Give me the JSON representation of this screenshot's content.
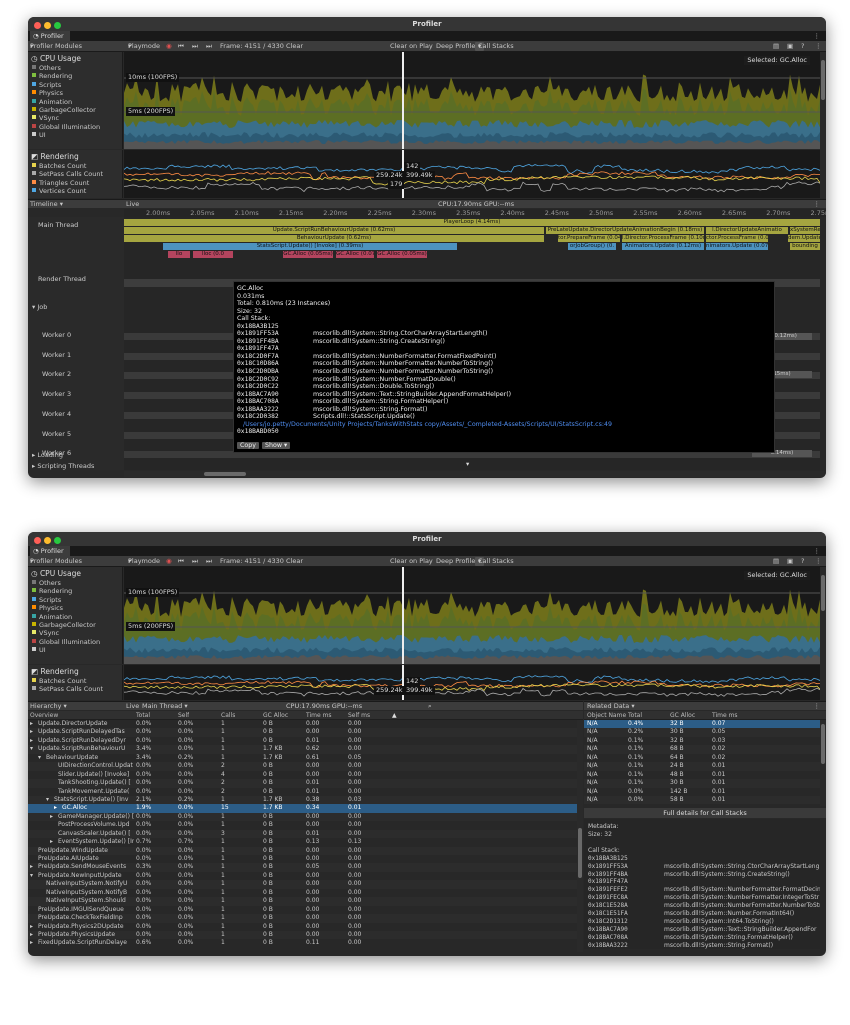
{
  "window": {
    "title": "Profiler",
    "tab": "Profiler"
  },
  "toolbar": {
    "modules": "Profiler Modules",
    "playmode": "Playmode",
    "frame": "Frame: 4151 / 4330",
    "clear": "Clear",
    "clear_on_play": "Clear on Play",
    "deep_profile": "Deep Profile",
    "call_stacks": "Call Stacks"
  },
  "cpu": {
    "title": "CPU Usage",
    "legend": [
      {
        "label": "Others",
        "color": "#777777"
      },
      {
        "label": "Rendering",
        "color": "#7fbf3f"
      },
      {
        "label": "Scripts",
        "color": "#4fa7e3"
      },
      {
        "label": "Physics",
        "color": "#ff8c00"
      },
      {
        "label": "Animation",
        "color": "#37a5a5"
      },
      {
        "label": "GarbageCollector",
        "color": "#c8b400"
      },
      {
        "label": "VSync",
        "color": "#e8e868"
      },
      {
        "label": "Global Illumination",
        "color": "#bb4444"
      },
      {
        "label": "UI",
        "color": "#cccccc"
      }
    ],
    "label_10": "10ms (100FPS)",
    "label_5": "5ms (200FPS)",
    "selected": "Selected: GC.Alloc"
  },
  "rendering": {
    "title": "Rendering",
    "legend": [
      {
        "label": "Batches Count",
        "color": "#e8d44d"
      },
      {
        "label": "SetPass Calls Count",
        "color": "#aaaaaa"
      },
      {
        "label": "Triangles Count",
        "color": "#ff8c44"
      },
      {
        "label": "Vertices Count",
        "color": "#4fa7e3"
      }
    ],
    "values": [
      "142",
      "259.24k",
      "399.49k",
      "179"
    ]
  },
  "timeline": {
    "view": "Timeline",
    "live": "Live",
    "cpu": "CPU:17.90ms  GPU:--ms",
    "ticks": [
      "2.00ms",
      "2.05ms",
      "2.10ms",
      "2.15ms",
      "2.20ms",
      "2.25ms",
      "2.30ms",
      "2.35ms",
      "2.40ms",
      "2.45ms",
      "2.50ms",
      "2.55ms",
      "2.60ms",
      "2.65ms",
      "2.70ms",
      "2.75ms"
    ],
    "threads": {
      "main": "Main Thread",
      "render": "Render Thread",
      "job": "Job",
      "workers": [
        "Worker 0",
        "Worker 1",
        "Worker 2",
        "Worker 3",
        "Worker 4",
        "Worker 5",
        "Worker 6"
      ],
      "loading": "Loading",
      "scripting": "Scripting Threads"
    },
    "bars": {
      "player_loop": "PlayerLoop (4.14ms)",
      "run_behaviour": "Update.ScriptRunBehaviourUpdate (0.62ms)",
      "behaviour_update": "BehaviourUpdate (0.62ms)",
      "stats_update": "StatsScript.Update() [Invoke] (0.39ms)",
      "pre_late": "PreLateUpdate.DirectorUpdateAnimationBegin (0.18ms)",
      "director_anim": "l.DirectorUpdateAnimatio",
      "system": "xSystemRe",
      "prepare_frame": "tor.PrepareFrame (0.04ms)",
      "process_frame": "l.Director.ProcessFrame (0.10ms)",
      "process_frame2": "ctor.ProcessFrame (0.07",
      "item_update": "dem.Update",
      "job_group": "orJobGroup() (0.",
      "anim_update": "Animators.Update (0.12ms)",
      "anim_update2": "nimators.Update (0.07m",
      "bounding": "bounding",
      "gc1": "GC.Alloc (0.05ms)",
      "gc2": "GC.Alloc (0.07ms)",
      "gc3": "GC.Alloc (0.05ms)",
      "gc_short": "llo",
      "gc_short2": "lloc (0.0",
      "worker0_time": "e (0.12ms)",
      "worker2_time": "15ms)",
      "worker6_time": "0.14ms)"
    }
  },
  "tooltip": {
    "name": "GC.Alloc",
    "time": "0.031ms",
    "total": "Total: 0.810ms (23 Instances)",
    "size": "Size: 32",
    "call_stack": "Call Stack:",
    "rows": [
      {
        "addr": "0x18BA3B125",
        "fn": ""
      },
      {
        "addr": "0x1891FF53A",
        "fn": "mscorlib.dll!System::String.CtorCharArrayStartLength()"
      },
      {
        "addr": "0x1891FF4BA",
        "fn": "mscorlib.dll!System::String.CreateString()"
      },
      {
        "addr": "0x1891FF47A",
        "fn": ""
      },
      {
        "addr": "0x18C2D0F7A",
        "fn": "mscorlib.dll!System::NumberFormatter.FormatFixedPoint()"
      },
      {
        "addr": "0x18C10D86A",
        "fn": "mscorlib.dll!System::NumberFormatter.NumberToString()"
      },
      {
        "addr": "0x18C2D0DBA",
        "fn": "mscorlib.dll!System::NumberFormatter.NumberToString()"
      },
      {
        "addr": "0x18C2D0C92",
        "fn": "mscorlib.dll!System::Number.FormatDouble()"
      },
      {
        "addr": "0x18C2D0C22",
        "fn": "mscorlib.dll!System::Double.ToString()"
      },
      {
        "addr": "0x18BAC7A90",
        "fn": "mscorlib.dll!System::Text::StringBuilder.AppendFormatHelper()"
      },
      {
        "addr": "0x18BAC708A",
        "fn": "mscorlib.dll!System::String.FormatHelper()"
      },
      {
        "addr": "0x18BAA3222",
        "fn": "mscorlib.dll!System::String.Format()"
      },
      {
        "addr": "0x18C2D0382",
        "fn": "Scripts.dll!::StatsScript.Update()"
      },
      {
        "addr": "0x18BABD050",
        "fn": ""
      }
    ],
    "path": "/Users/jo.petty/Documents/Unity Projects/TanksWithStats copy/Assets/_Completed-Assets/Scripts/UI/StatsScript.cs:49",
    "copy": "Copy",
    "show": "Show"
  },
  "hierarchy": {
    "view": "Hierarchy",
    "live": "Live",
    "thread": "Main Thread",
    "cpu": "CPU:17.90ms  GPU:--ms",
    "columns": [
      "Overview",
      "Total",
      "Self",
      "Calls",
      "GC Alloc",
      "Time ms",
      "Self ms"
    ],
    "rows": [
      [
        "Update.DirectorUpdate",
        "0.0%",
        "0.0%",
        "1",
        "0 B",
        "0.00",
        "0.00"
      ],
      [
        "Update.ScriptRunDelayedTas",
        "0.0%",
        "0.0%",
        "1",
        "0 B",
        "0.00",
        "0.00"
      ],
      [
        "Update.ScriptRunDelayedDyr",
        "0.0%",
        "0.0%",
        "1",
        "0 B",
        "0.01",
        "0.00"
      ],
      [
        "Update.ScriptRunBehaviourU",
        "3.4%",
        "0.0%",
        "1",
        "1.7 KB",
        "0.62",
        "0.00"
      ],
      [
        "BehaviourUpdate",
        "3.4%",
        "0.2%",
        "1",
        "1.7 KB",
        "0.61",
        "0.05"
      ],
      [
        "UIDirectionControl.Updat",
        "0.0%",
        "0.0%",
        "2",
        "0 B",
        "0.00",
        "0.00"
      ],
      [
        "Slider.Update() [Invoke]",
        "0.0%",
        "0.0%",
        "4",
        "0 B",
        "0.00",
        "0.00"
      ],
      [
        "TankShooting.Update() [",
        "0.0%",
        "0.0%",
        "2",
        "0 B",
        "0.01",
        "0.00"
      ],
      [
        "TankMovement.Update(",
        "0.0%",
        "0.0%",
        "2",
        "0 B",
        "0.01",
        "0.00"
      ],
      [
        "StatsScript.Update() [Inv",
        "2.1%",
        "0.2%",
        "1",
        "1.7 KB",
        "0.38",
        "0.03"
      ],
      [
        "GC.Alloc",
        "1.9%",
        "0.0%",
        "15",
        "1.7 KB",
        "0.34",
        "0.01"
      ],
      [
        "GameManager.Update() [",
        "0.0%",
        "0.0%",
        "1",
        "0 B",
        "0.00",
        "0.00"
      ],
      [
        "PostProcessVolume.Upd",
        "0.0%",
        "0.0%",
        "1",
        "0 B",
        "0.00",
        "0.00"
      ],
      [
        "CanvasScaler.Update() [",
        "0.0%",
        "0.0%",
        "3",
        "0 B",
        "0.01",
        "0.00"
      ],
      [
        "EventSystem.Update() [Ir",
        "0.7%",
        "0.7%",
        "1",
        "0 B",
        "0.13",
        "0.13"
      ],
      [
        "PreUpdate.WindUpdate",
        "0.0%",
        "0.0%",
        "1",
        "0 B",
        "0.00",
        "0.00"
      ],
      [
        "PreUpdate.AIUpdate",
        "0.0%",
        "0.0%",
        "1",
        "0 B",
        "0.00",
        "0.00"
      ],
      [
        "PreUpdate.SendMouseEvents",
        "0.3%",
        "0.0%",
        "1",
        "0 B",
        "0.05",
        "0.00"
      ],
      [
        "PreUpdate.NewInputUpdate",
        "0.0%",
        "0.0%",
        "1",
        "0 B",
        "0.00",
        "0.00"
      ],
      [
        "NativeInputSystem.NotifyU",
        "0.0%",
        "0.0%",
        "1",
        "0 B",
        "0.00",
        "0.00"
      ],
      [
        "NativeInputSystem.NotifyB",
        "0.0%",
        "0.0%",
        "1",
        "0 B",
        "0.00",
        "0.00"
      ],
      [
        "NativeInputSystem.Should",
        "0.0%",
        "0.0%",
        "1",
        "0 B",
        "0.00",
        "0.00"
      ],
      [
        "PreUpdate.IMGUISendQueue",
        "0.0%",
        "0.0%",
        "1",
        "0 B",
        "0.00",
        "0.00"
      ],
      [
        "PreUpdate.CheckTexFieldInp",
        "0.0%",
        "0.0%",
        "1",
        "0 B",
        "0.00",
        "0.00"
      ],
      [
        "PreUpdate.Physics2DUpdate",
        "0.0%",
        "0.0%",
        "1",
        "0 B",
        "0.00",
        "0.00"
      ],
      [
        "PreUpdate.PhysicsUpdate",
        "0.0%",
        "0.0%",
        "1",
        "0 B",
        "0.00",
        "0.00"
      ],
      [
        "FixedUpdate.ScriptRunDelaye",
        "0.6%",
        "0.0%",
        "1",
        "0 B",
        "0.11",
        "0.00"
      ]
    ]
  },
  "related": {
    "view": "Related Data",
    "columns": [
      "Object Name",
      "Total",
      "GC Alloc",
      "Time ms"
    ],
    "rows": [
      [
        "N/A",
        "0.4%",
        "32 B",
        "0.07"
      ],
      [
        "N/A",
        "0.2%",
        "30 B",
        "0.05"
      ],
      [
        "N/A",
        "0.1%",
        "32 B",
        "0.03"
      ],
      [
        "N/A",
        "0.1%",
        "68 B",
        "0.02"
      ],
      [
        "N/A",
        "0.1%",
        "64 B",
        "0.02"
      ],
      [
        "N/A",
        "0.1%",
        "24 B",
        "0.01"
      ],
      [
        "N/A",
        "0.1%",
        "48 B",
        "0.01"
      ],
      [
        "N/A",
        "0.1%",
        "30 B",
        "0.01"
      ],
      [
        "N/A",
        "0.0%",
        "142 B",
        "0.01"
      ],
      [
        "N/A",
        "0.0%",
        "58 B",
        "0.01"
      ]
    ],
    "full_details": "Full details for Call Stacks",
    "metadata": "Metadata:",
    "size": "Size: 32",
    "call_stack": "Call Stack:",
    "stack": [
      {
        "addr": "0x18BA3B125",
        "fn": ""
      },
      {
        "addr": "0x1891FF53A",
        "fn": "mscorlib.dll!System::String.CtorCharArrayStartLeng"
      },
      {
        "addr": "0x1891FF4BA",
        "fn": "mscorlib.dll!System::String.CreateString()"
      },
      {
        "addr": "0x1891FF47A",
        "fn": ""
      },
      {
        "addr": "0x1891FEFE2",
        "fn": "mscorlib.dll!System::NumberFormatter.FormatDecin"
      },
      {
        "addr": "0x1891FEC8A",
        "fn": "mscorlib.dll!System::NumberFormatter.IntegerToStr"
      },
      {
        "addr": "0x18C1E528A",
        "fn": "mscorlib.dll!System::NumberFormatter.NumberToStr"
      },
      {
        "addr": "0x18C1E51FA",
        "fn": "mscorlib.dll!System::Number.FormatInt64()"
      },
      {
        "addr": "0x18C2D1312",
        "fn": "mscorlib.dll!System::Int64.ToString()"
      },
      {
        "addr": "0x18BAC7A90",
        "fn": "mscorlib.dll!System::Text::StringBuilder.AppendFor"
      },
      {
        "addr": "0x18BAC708A",
        "fn": "mscorlib.dll!System::String.FormatHelper()"
      },
      {
        "addr": "0x18BAA3222",
        "fn": "mscorlib.dll!System::String.Format()"
      }
    ]
  }
}
